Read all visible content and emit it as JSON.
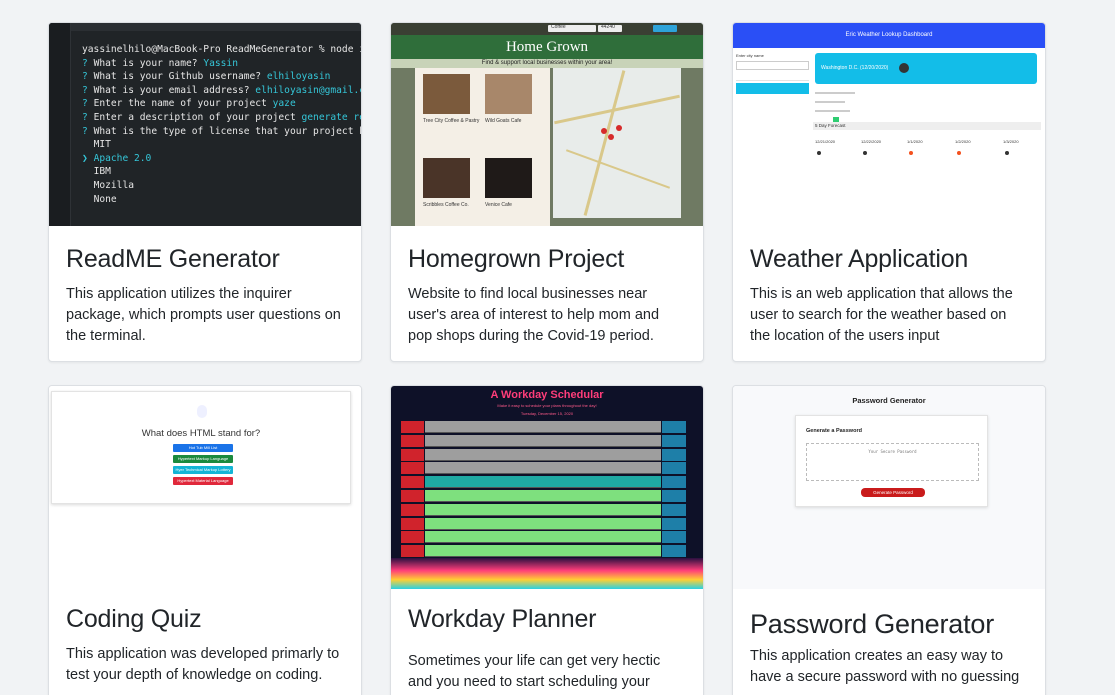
{
  "colors": {
    "page_bg": "#f1f3f5",
    "card_bg": "#ffffff",
    "text": "#212529"
  },
  "projects": [
    {
      "title": "ReadME Generator",
      "description": "This application utilizes the inquirer package, which prompts user questions on the terminal.",
      "preview": {
        "lines": [
          {
            "prefix": "",
            "text": "yassinelhilo@MacBook-Pro ReadMeGenerator % node index.js",
            "answer": ""
          },
          {
            "prefix": "? ",
            "text": "What is your name? ",
            "answer": "Yassin"
          },
          {
            "prefix": "? ",
            "text": "What is your Github username? ",
            "answer": "elhiloyasin"
          },
          {
            "prefix": "? ",
            "text": "What is your email address? ",
            "answer": "elhiloyasin@gmail.com"
          },
          {
            "prefix": "? ",
            "text": "Enter the name of your project ",
            "answer": "yaze"
          },
          {
            "prefix": "? ",
            "text": "Enter a description of your project ",
            "answer": "generate read me"
          },
          {
            "prefix": "? ",
            "text": "What is the type of license that your project has?",
            "answer": ""
          },
          {
            "prefix": "  ",
            "text": "MIT",
            "answer": ""
          },
          {
            "prefix": "❯ ",
            "text": "",
            "answer": "Apache 2.0"
          },
          {
            "prefix": "  ",
            "text": "IBM",
            "answer": ""
          },
          {
            "prefix": "  ",
            "text": "Mozilla",
            "answer": ""
          },
          {
            "prefix": "  ",
            "text": "None",
            "answer": ""
          }
        ]
      }
    },
    {
      "title": "Homegrown Project",
      "description": "Website to find local businesses near user's area of interest to help mom and pop shops during the Covid-19 period.",
      "preview": {
        "banner": "Home Grown",
        "subtitle": "Find & support local businesses within your area!",
        "search_value": "Coffee",
        "zip_value": "44240",
        "businesses": [
          "Tree City Coffee & Pastry",
          "Wild Goats Cafe",
          "Scribbles Coffee Co.",
          "Venice Cafe"
        ]
      }
    },
    {
      "title": "Weather Application",
      "description": "This is an web application that allows the user to search for the weather based on the location of the users input",
      "preview": {
        "header": "Eric Weather Lookup Dashboard",
        "city_label": "Enter city name",
        "current_city": "Washington D.C. (12/20/2020)",
        "forecast_label": "5 Day Forecast",
        "forecast_dates": [
          "12/21/2020",
          "12/22/2020",
          "1/1/2020",
          "1/2/2020",
          "1/3/2020"
        ]
      }
    },
    {
      "title": "Coding Quiz",
      "description": "This application was developed primarly to test your depth of knowledge on coding.",
      "preview": {
        "question": "What does HTML stand for?",
        "options": [
          "Hot Tub Mill List",
          "Hypertext Markup Language",
          "Hyer Techmical Markup Lottery",
          "Hypertext Material Language"
        ]
      }
    },
    {
      "title": "Workday Planner",
      "description": "Sometimes your life can get very hectic and you need to start scheduling your",
      "preview": {
        "title": "A Workday Schedular",
        "subtitle": "Make it easy to schedule your plans throughout the day!",
        "date": "Tuesday, December 15, 2020"
      }
    },
    {
      "title": "Password Generator",
      "description": "This application creates an easy way to have a secure password with no guessing",
      "preview": {
        "title": "Password Generator",
        "panel_title": "Generate a Password",
        "placeholder": "Your Secure Password",
        "button": "Generate Password"
      }
    }
  ]
}
